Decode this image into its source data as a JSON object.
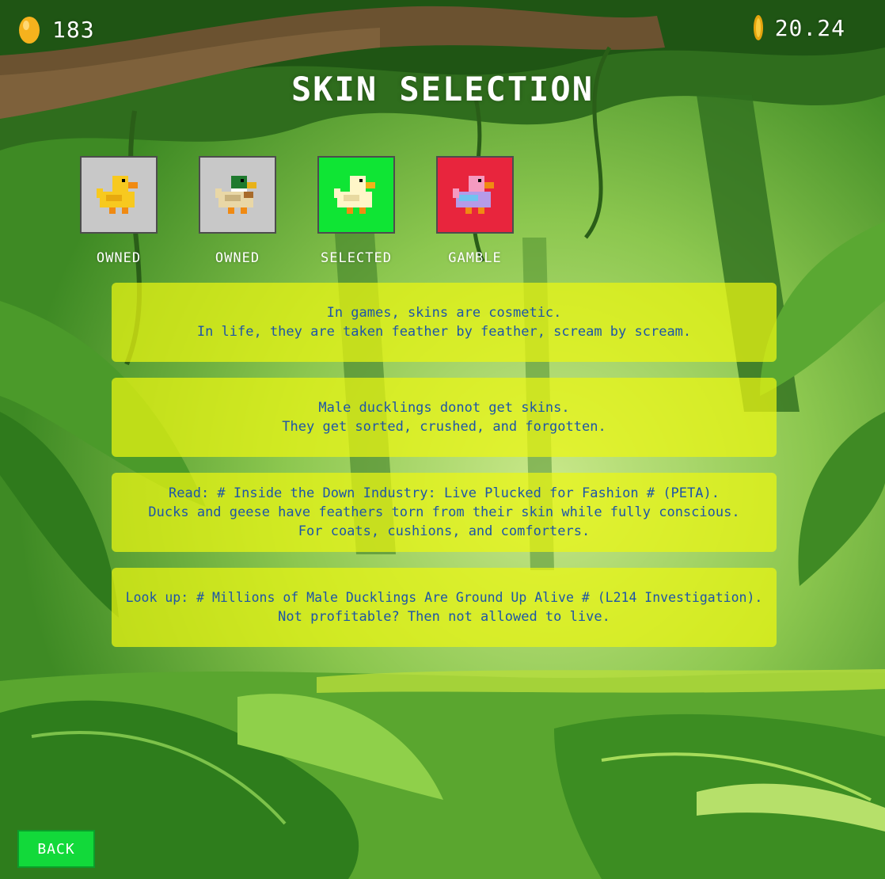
{
  "hud": {
    "eggs": "183",
    "coins": "20.24"
  },
  "title": "SKIN SELECTION",
  "skins": [
    {
      "name": "yellow duck",
      "status": "OWNED",
      "bg": "#c8c8c8"
    },
    {
      "name": "mallard duck",
      "status": "OWNED",
      "bg": "#c8c8c8"
    },
    {
      "name": "white duck",
      "status": "SELECTED",
      "bg": "#0fe534"
    },
    {
      "name": "pink duck",
      "status": "GAMBLE",
      "bg": "#e8253d"
    }
  ],
  "messages": [
    {
      "lines": [
        "In games, skins are cosmetic.",
        "In life, they are taken feather by feather, scream by scream."
      ]
    },
    {
      "lines": [
        "Male ducklings donot get skins.",
        "They get sorted, crushed, and forgotten."
      ]
    },
    {
      "lines": [
        "Read: # Inside the Down Industry: Live Plucked for Fashion # (PETA).",
        "Ducks and geese have feathers torn from their skin while fully conscious.",
        "For coats, cushions, and comforters."
      ]
    },
    {
      "lines": [
        "Look up: # Millions of Male Ducklings Are Ground Up Alive # (L214 Investigation).",
        "Not profitable? Then not allowed to live."
      ]
    }
  ],
  "back_label": "BACK",
  "colors": {
    "message_bg": "#ecf612",
    "message_text": "#1d55a8",
    "back_button": "#12d93a"
  },
  "icons": [
    "egg-icon",
    "coin-icon"
  ]
}
